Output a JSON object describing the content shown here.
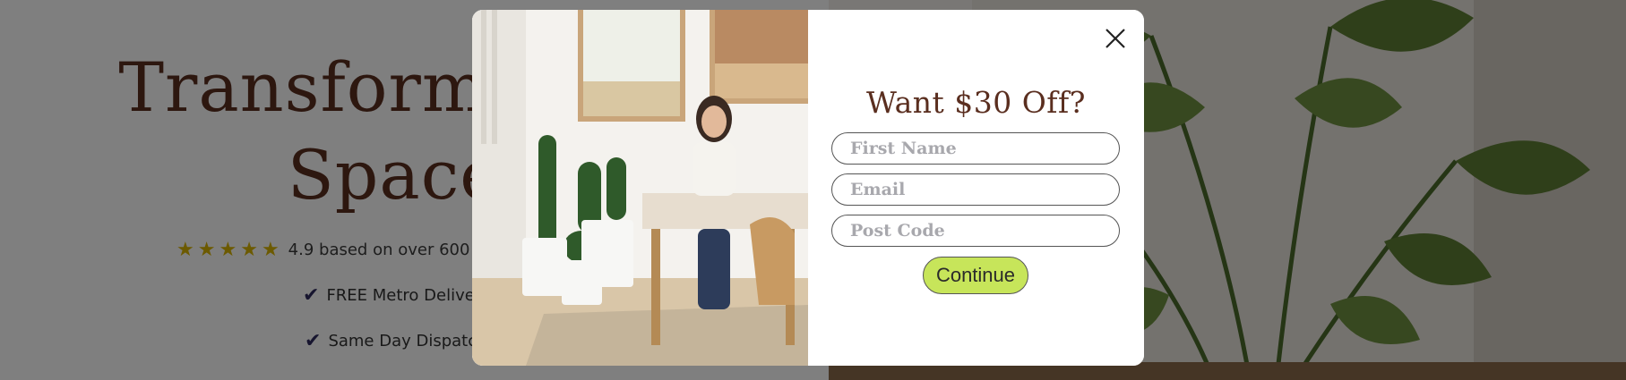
{
  "hero": {
    "title_line1": "Transform Your",
    "title_line2": "Space",
    "rating_text": "4.9 based on over 600",
    "star_count": 5,
    "features": [
      "FREE Metro Deliver",
      "Same Day Dispatc"
    ]
  },
  "popup": {
    "title": "Want $30 Off?",
    "fields": {
      "first_name_placeholder": "First Name",
      "email_placeholder": "Email",
      "post_code_placeholder": "Post Code"
    },
    "continue_label": "Continue"
  },
  "colors": {
    "brand_brown": "#5a2e1f",
    "accent_green": "#c7e55a",
    "star_gold": "#d8b400",
    "check_navy": "#2e2a5e"
  }
}
